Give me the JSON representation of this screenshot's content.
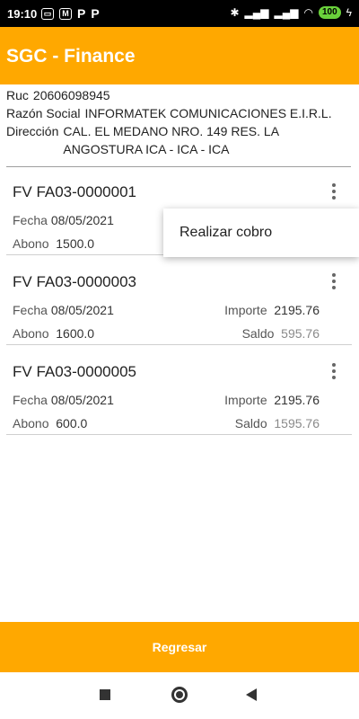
{
  "status_bar": {
    "time": "19:10",
    "left_icons": [
      "mail-icon",
      "message-icon",
      "parking-icon",
      "parking-icon"
    ],
    "right_icons": [
      "bluetooth-icon",
      "signal-icon",
      "signal-icon",
      "wifi-icon",
      "battery-icon",
      "charging-icon"
    ],
    "battery_level": "100"
  },
  "header": {
    "title": "SGC - Finance",
    "color": "#FFA800"
  },
  "customer": {
    "ruc_label": "Ruc",
    "ruc_value": "20606098945",
    "razon_label": "Razón Social",
    "razon_value": "INFORMATEK COMUNICACIONES E.I.R.L.",
    "direccion_label": "Dirección",
    "direccion_value": "CAL. EL MEDANO NRO. 149 RES. LA ANGOSTURA ICA - ICA - ICA"
  },
  "invoices": [
    {
      "number": "FV FA03-0000001",
      "fecha_label": "Fecha",
      "fecha": "08/05/2021",
      "importe_label": "",
      "importe": "",
      "abono_label": "Abono",
      "abono": "1500.0",
      "saldo_label": "",
      "saldo": ""
    },
    {
      "number": "FV FA03-0000003",
      "fecha_label": "Fecha",
      "fecha": "08/05/2021",
      "importe_label": "Importe",
      "importe": "2195.76",
      "abono_label": "Abono",
      "abono": "1600.0",
      "saldo_label": "Saldo",
      "saldo": "595.76"
    },
    {
      "number": "FV FA03-0000005",
      "fecha_label": "Fecha",
      "fecha": "08/05/2021",
      "importe_label": "Importe",
      "importe": "2195.76",
      "abono_label": "Abono",
      "abono": "600.0",
      "saldo_label": "Saldo",
      "saldo": "1595.76"
    }
  ],
  "popup_menu": {
    "item_label": "Realizar cobro"
  },
  "footer": {
    "back_label": "Regresar"
  },
  "nav_bar": {
    "icons": [
      "recent-apps-icon",
      "home-icon",
      "back-icon"
    ]
  }
}
